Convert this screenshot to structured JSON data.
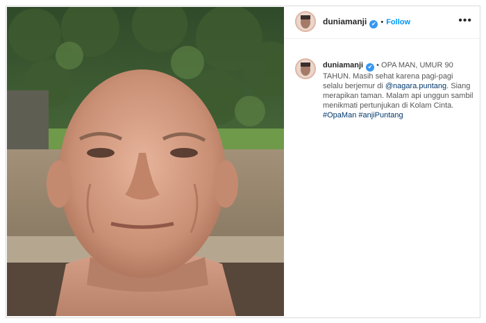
{
  "post": {
    "username": "duniamanji",
    "separator": "•",
    "follow_label": "Follow",
    "more_icon": "more-horizontal-icon",
    "verified_icon": "verified-badge-icon",
    "caption": {
      "part1": "• OPA MAN, UMUR 90 TAHUN. Masih sehat karena pagi-pagi selalu berjemur di",
      "mention": "@nagara.puntang",
      "part2": ". Siang merapikan taman. Malam api unggun sambil menikmati pertunjukan di Kolam Cinta.",
      "hashtag1": "#OpaMan",
      "hashtag2": "#anjiPuntang"
    }
  },
  "colors": {
    "accent": "#0095f6",
    "verified": "#3897f0",
    "link": "#00376b",
    "border": "#dbdbdb"
  }
}
